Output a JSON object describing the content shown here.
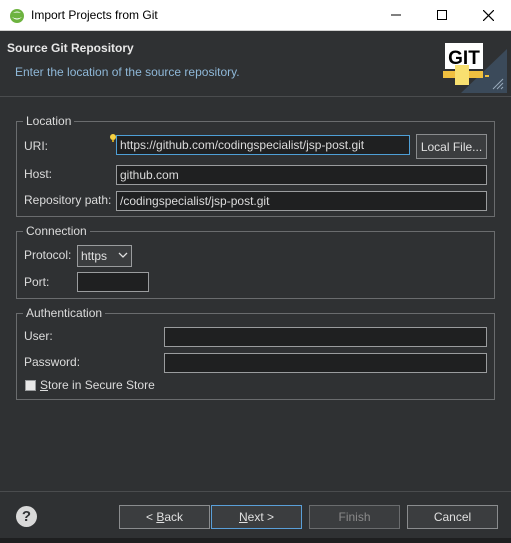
{
  "window": {
    "title": "Import Projects from Git"
  },
  "header": {
    "title": "Source Git Repository",
    "description": "Enter the location of the source repository.",
    "logo_text": "GIT"
  },
  "location": {
    "legend": "Location",
    "uri_label": "URI:",
    "uri_value": "https://github.com/codingspecialist/jsp-post.git",
    "local_file_button": "Local File...",
    "host_label": "Host:",
    "host_value": "github.com",
    "repo_path_label": "Repository path:",
    "repo_path_value": "/codingspecialist/jsp-post.git"
  },
  "connection": {
    "legend": "Connection",
    "protocol_label": "Protocol:",
    "protocol_value": "https",
    "port_label": "Port:",
    "port_value": ""
  },
  "authentication": {
    "legend": "Authentication",
    "user_label": "User:",
    "user_value": "",
    "password_label": "Password:",
    "password_value": "",
    "store_label_prefix": "S",
    "store_label_rest": "tore in Secure Store",
    "store_checked": false
  },
  "footer": {
    "back_prefix": "< ",
    "back_mnemonic": "B",
    "back_rest": "ack",
    "next_mnemonic": "N",
    "next_rest": "ext >",
    "finish_label": "Finish",
    "cancel_label": "Cancel"
  },
  "colors": {
    "background": "#2f3133",
    "accent": "#4e9fd6",
    "description": "#8fb8d8"
  }
}
